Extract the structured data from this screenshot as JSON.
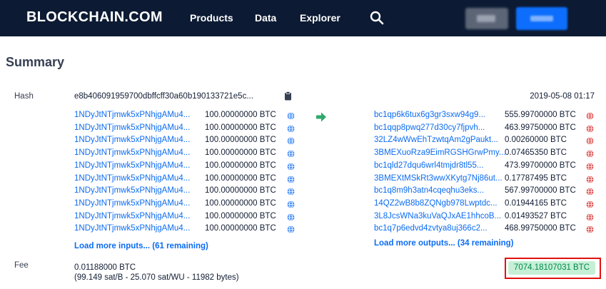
{
  "header": {
    "logo": "BLOCKCHAIN.COM",
    "nav": {
      "products": "Products",
      "data": "Data",
      "explorer": "Explorer"
    },
    "bg_color": "#0c1a33"
  },
  "summary": {
    "title": "Summary",
    "hash_label": "Hash",
    "hash_value": "e8b406091959700dbffcff30a60b190133721e5c...",
    "date": "2019-05-08 01:17",
    "inputs": [
      {
        "address": "1NDyJtNTjmwk5xPNhjgAMu4...",
        "amount": "100.00000000 BTC"
      },
      {
        "address": "1NDyJtNTjmwk5xPNhjgAMu4...",
        "amount": "100.00000000 BTC"
      },
      {
        "address": "1NDyJtNTjmwk5xPNhjgAMu4...",
        "amount": "100.00000000 BTC"
      },
      {
        "address": "1NDyJtNTjmwk5xPNhjgAMu4...",
        "amount": "100.00000000 BTC"
      },
      {
        "address": "1NDyJtNTjmwk5xPNhjgAMu4...",
        "amount": "100.00000000 BTC"
      },
      {
        "address": "1NDyJtNTjmwk5xPNhjgAMu4...",
        "amount": "100.00000000 BTC"
      },
      {
        "address": "1NDyJtNTjmwk5xPNhjgAMu4...",
        "amount": "100.00000000 BTC"
      },
      {
        "address": "1NDyJtNTjmwk5xPNhjgAMu4...",
        "amount": "100.00000000 BTC"
      },
      {
        "address": "1NDyJtNTjmwk5xPNhjgAMu4...",
        "amount": "100.00000000 BTC"
      },
      {
        "address": "1NDyJtNTjmwk5xPNhjgAMu4...",
        "amount": "100.00000000 BTC"
      }
    ],
    "outputs": [
      {
        "address": "bc1qp6k6tux6g3gr3sxw94g9...",
        "amount": "555.99700000 BTC"
      },
      {
        "address": "bc1qqp8pwq277d30cy7fjpvh...",
        "amount": "463.99750000 BTC"
      },
      {
        "address": "32LZ4wWwEhTzwtqAm2gPaukt...",
        "amount": "0.00260000 BTC"
      },
      {
        "address": "3BMEXuoRza9EimRGSHGrwPmy...",
        "amount": "0.07465350 BTC"
      },
      {
        "address": "bc1qld27dqu6wrl4tmjdr8tl55...",
        "amount": "473.99700000 BTC"
      },
      {
        "address": "3BMEXtMSkRt3wwXKytg7Nj86ut...",
        "amount": "0.17787495 BTC"
      },
      {
        "address": "bc1q8m9h3atn4cqeqhu3eks...",
        "amount": "567.99700000 BTC"
      },
      {
        "address": "14QZ2wB8b8ZQNgb978Lwptdc...",
        "amount": "0.01944165 BTC"
      },
      {
        "address": "3L8JcsWNa3kuVaQJxAE1hhcoB...",
        "amount": "0.01493527 BTC"
      },
      {
        "address": "bc1q7p6edvd4zvtya8uj366c2...",
        "amount": "468.99750000 BTC"
      }
    ],
    "load_more_inputs": "Load more inputs... (61 remaining)",
    "load_more_outputs": "Load more outputs... (34 remaining)",
    "fee_label": "Fee",
    "fee_value": "0.01188000 BTC",
    "fee_detail": "(99.149 sat/B - 25.070 sat/WU - 11982 bytes)",
    "total": "7074.18107031 BTC"
  },
  "colors": {
    "link": "#0c6cf2",
    "input_globe": "#3d89f5",
    "output_globe": "#e04a4a",
    "arrow": "#2eaa6a",
    "total_bg": "#c6f0d6",
    "total_text": "#00894f",
    "highlight": "#e0120f"
  }
}
